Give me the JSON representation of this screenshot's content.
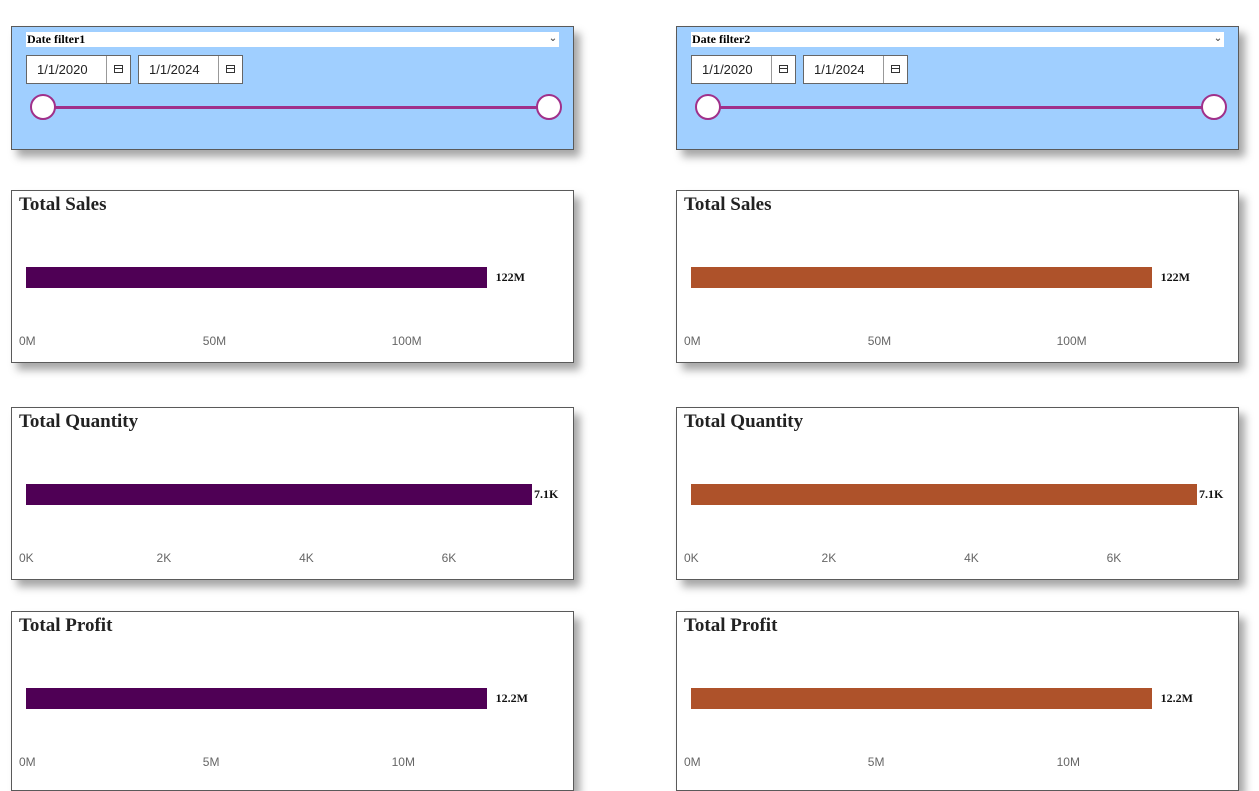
{
  "colors": {
    "slicer_bg": "#a0cfff",
    "slider_accent": "#a0308a",
    "left_bar": "#4f0055",
    "right_bar": "#ae522a"
  },
  "panels": [
    {
      "filter": {
        "title": "Date filter1",
        "start_date": "1/1/2020",
        "end_date": "1/1/2024",
        "range_fraction": [
          0,
          1
        ]
      },
      "charts": [
        {
          "title": "Total Sales",
          "value": 122,
          "value_label": "122M",
          "xlim": [
            0,
            134
          ],
          "ticks": [
            {
              "v": 0,
              "label": "0M"
            },
            {
              "v": 50,
              "label": "50M"
            },
            {
              "v": 100,
              "label": "100M"
            }
          ]
        },
        {
          "title": "Total Quantity",
          "value": 7.1,
          "value_label": "7.1K",
          "xlim": [
            0,
            7.1
          ],
          "ticks": [
            {
              "v": 0,
              "label": "0K"
            },
            {
              "v": 2,
              "label": "2K"
            },
            {
              "v": 4,
              "label": "4K"
            },
            {
              "v": 6,
              "label": "6K"
            }
          ]
        },
        {
          "title": "Total Profit",
          "value": 12.2,
          "value_label": "12.2M",
          "xlim": [
            0,
            13.4
          ],
          "ticks": [
            {
              "v": 0,
              "label": "0M"
            },
            {
              "v": 5,
              "label": "5M"
            },
            {
              "v": 10,
              "label": "10M"
            }
          ]
        }
      ]
    },
    {
      "filter": {
        "title": "Date filter2",
        "start_date": "1/1/2020",
        "end_date": "1/1/2024",
        "range_fraction": [
          0,
          1
        ]
      },
      "charts": [
        {
          "title": "Total Sales",
          "value": 122,
          "value_label": "122M",
          "xlim": [
            0,
            134
          ],
          "ticks": [
            {
              "v": 0,
              "label": "0M"
            },
            {
              "v": 50,
              "label": "50M"
            },
            {
              "v": 100,
              "label": "100M"
            }
          ]
        },
        {
          "title": "Total Quantity",
          "value": 7.1,
          "value_label": "7.1K",
          "xlim": [
            0,
            7.1
          ],
          "ticks": [
            {
              "v": 0,
              "label": "0K"
            },
            {
              "v": 2,
              "label": "2K"
            },
            {
              "v": 4,
              "label": "4K"
            },
            {
              "v": 6,
              "label": "6K"
            }
          ]
        },
        {
          "title": "Total Profit",
          "value": 12.2,
          "value_label": "12.2M",
          "xlim": [
            0,
            13.4
          ],
          "ticks": [
            {
              "v": 0,
              "label": "0M"
            },
            {
              "v": 5,
              "label": "5M"
            },
            {
              "v": 10,
              "label": "10M"
            }
          ]
        }
      ]
    }
  ]
}
